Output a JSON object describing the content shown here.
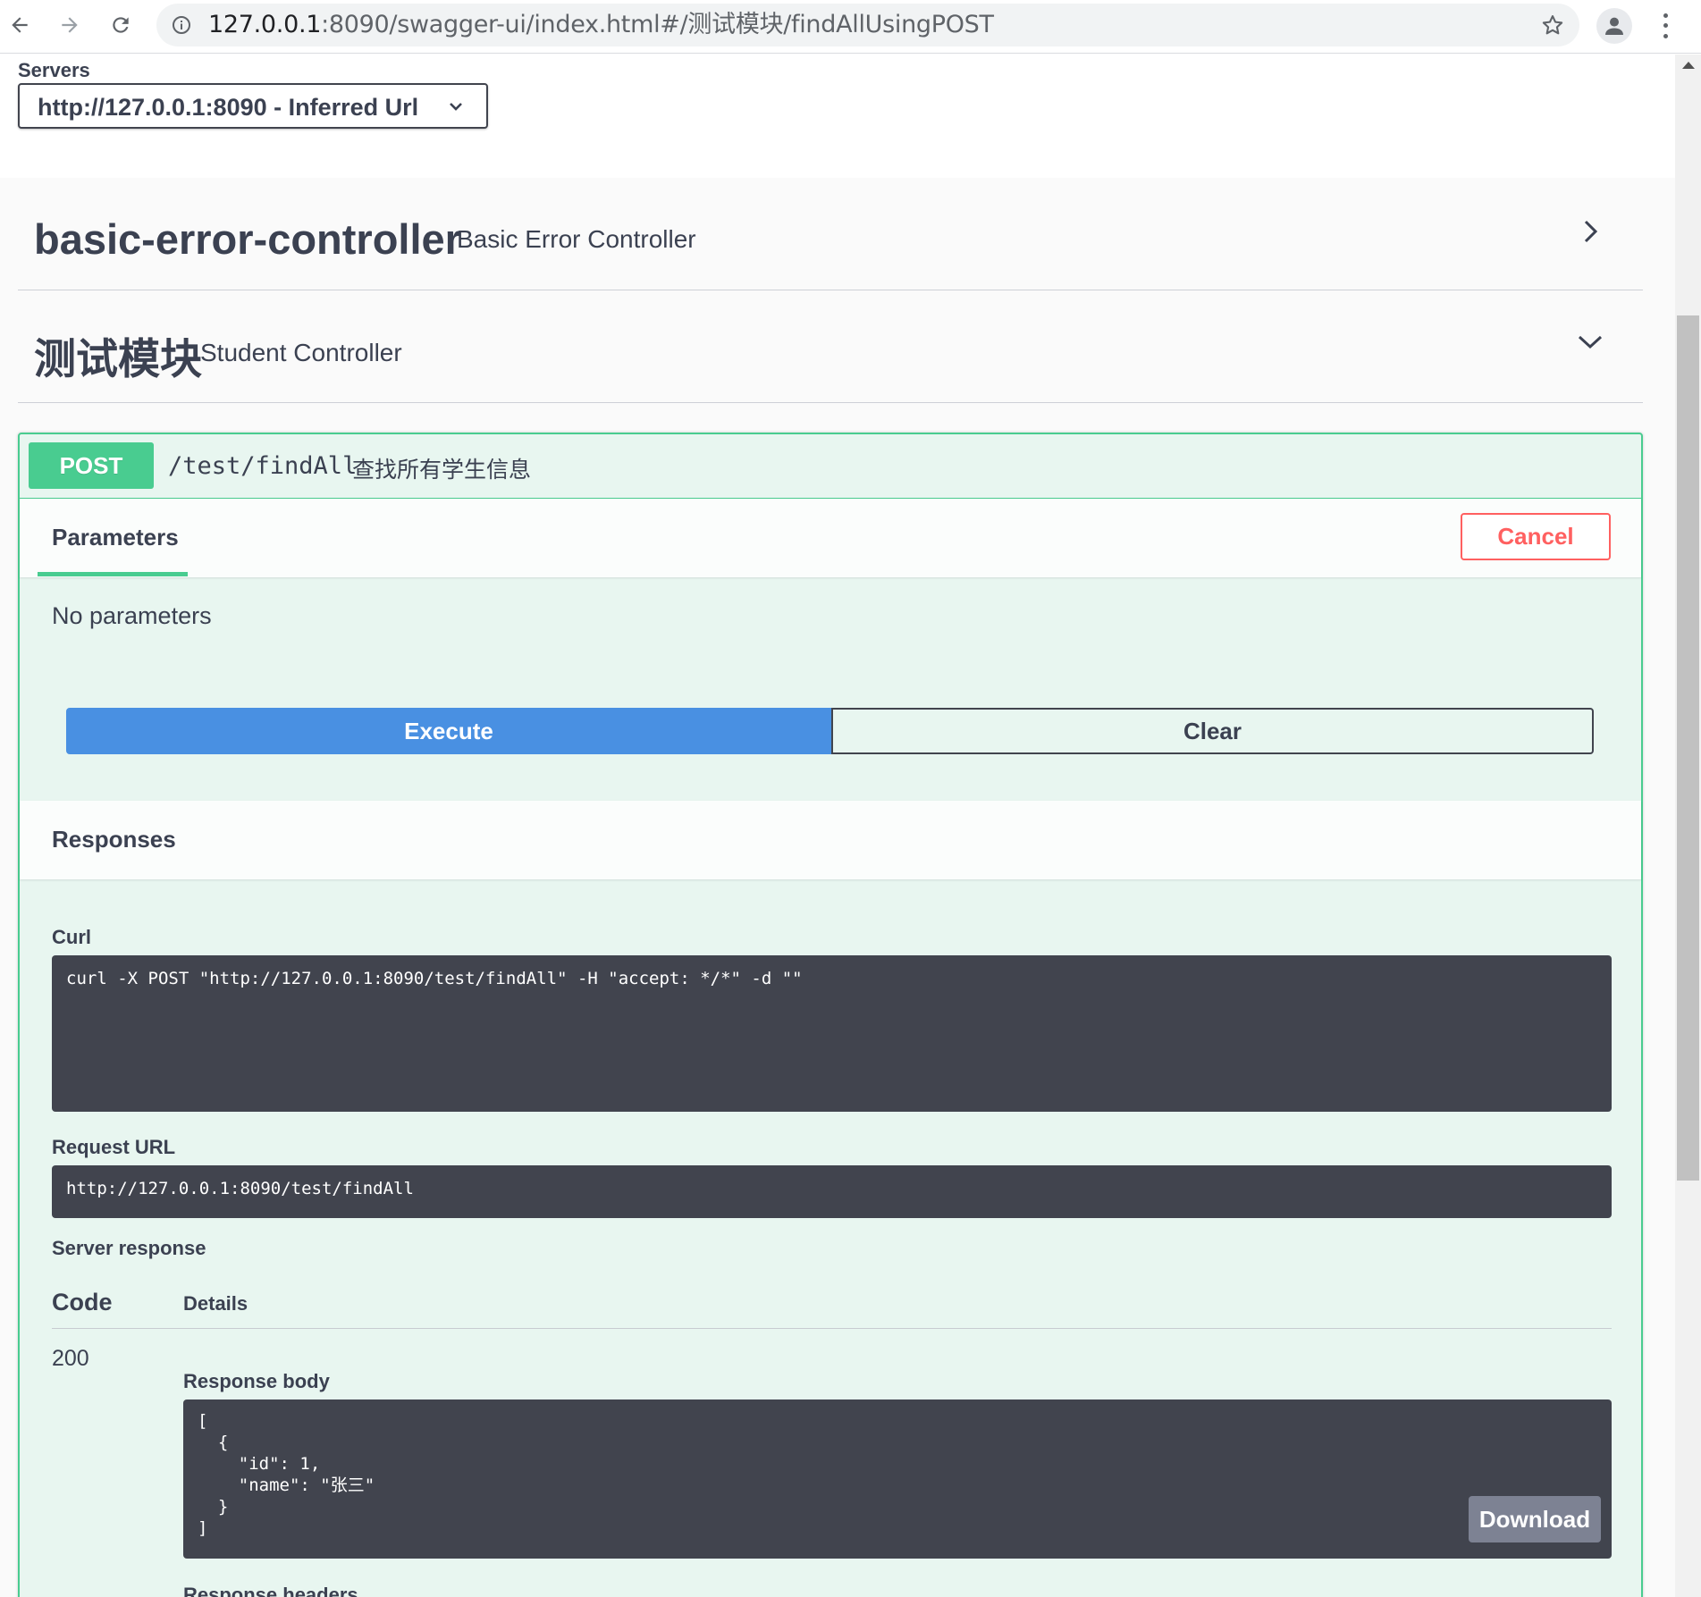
{
  "browser": {
    "url_host": "127.0.0.1",
    "url_rest": ":8090/swagger-ui/index.html#/测试模块/findAllUsingPOST"
  },
  "servers": {
    "label": "Servers",
    "selected": "http://127.0.0.1:8090 - Inferred Url"
  },
  "tags": [
    {
      "name": "basic-error-controller",
      "description": "Basic Error Controller"
    },
    {
      "name": "测试模块",
      "description": "Student Controller"
    }
  ],
  "operation": {
    "method": "POST",
    "path": "/test/findAll",
    "summary": "查找所有学生信息",
    "parameters_tab": "Parameters",
    "cancel_label": "Cancel",
    "no_parameters": "No parameters",
    "execute_label": "Execute",
    "clear_label": "Clear",
    "responses_title": "Responses",
    "curl_label": "Curl",
    "curl_command": "curl -X POST \"http://127.0.0.1:8090/test/findAll\" -H \"accept: */*\" -d \"\"",
    "request_url_label": "Request URL",
    "request_url": "http://127.0.0.1:8090/test/findAll",
    "server_response_label": "Server response",
    "code_header": "Code",
    "details_header": "Details",
    "status_code": "200",
    "response_body_label": "Response body",
    "response_body": "[\n  {\n    \"id\": 1,\n    \"name\": \"张三\"\n  }\n]",
    "download_label": "Download",
    "response_headers_label": "Response headers"
  },
  "colors": {
    "post_green": "#49cc90",
    "execute_blue": "#4990e2",
    "cancel_red": "#ff6060",
    "code_bg": "#41444e"
  },
  "icons": [
    "back-arrow-icon",
    "forward-arrow-icon",
    "reload-icon",
    "info-icon",
    "star-icon",
    "profile-icon",
    "more-vert-icon",
    "chevron-down-icon",
    "chevron-right-icon"
  ]
}
